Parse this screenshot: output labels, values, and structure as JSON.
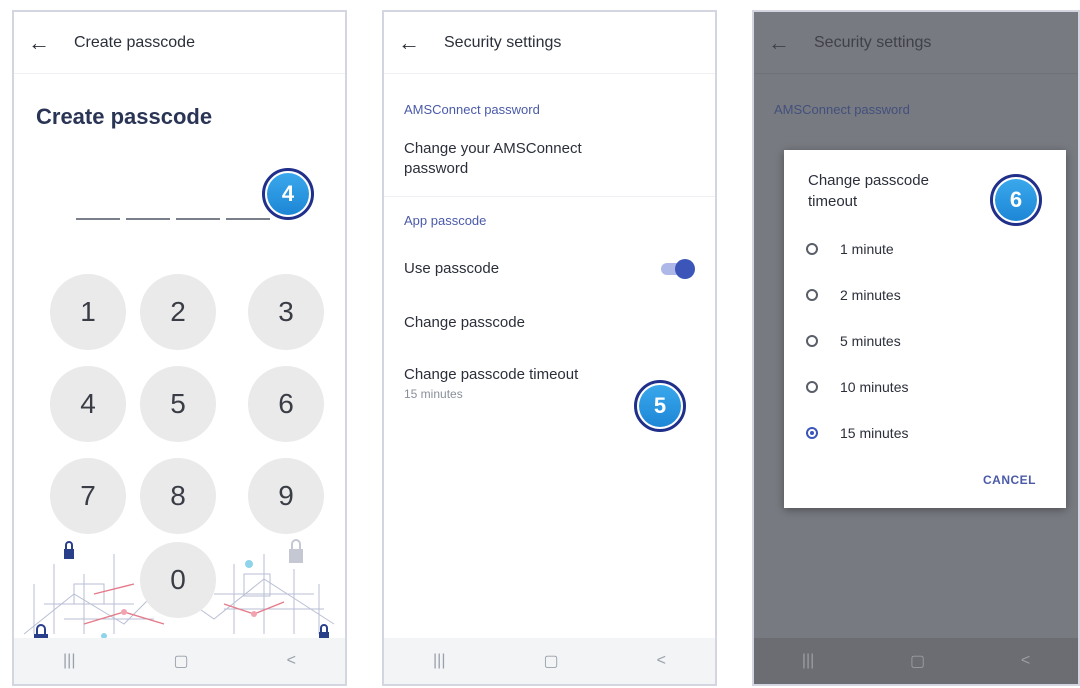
{
  "phone1": {
    "appbar_title": "Create passcode",
    "heading": "Create passcode",
    "keys": [
      "1",
      "2",
      "3",
      "4",
      "5",
      "6",
      "7",
      "8",
      "9",
      "0"
    ],
    "nav": [
      "|||",
      "▢",
      "<"
    ]
  },
  "phone2": {
    "appbar_title": "Security settings",
    "section1": "AMSConnect password",
    "change_password": "Change your AMSConnect password",
    "section2": "App passcode",
    "use_passcode": "Use passcode",
    "use_passcode_on": true,
    "change_passcode": "Change passcode",
    "timeout_label": "Change passcode timeout",
    "timeout_value": "15 minutes",
    "nav": [
      "|||",
      "▢",
      "<"
    ]
  },
  "phone3": {
    "appbar_title": "Security settings",
    "section1": "AMSConnect password",
    "dialog": {
      "title": "Change passcode timeout",
      "options": [
        "1 minute",
        "2 minutes",
        "5 minutes",
        "10 minutes",
        "15 minutes"
      ],
      "selected": "15 minutes",
      "cancel": "CANCEL"
    },
    "nav": [
      "|||",
      "▢",
      "<"
    ]
  },
  "steps": {
    "step4": "4",
    "step5": "5",
    "step6": "6"
  },
  "icons": {
    "back": "arrow-left-icon",
    "lock": "padlock-icon"
  },
  "colors": {
    "accent": "#3b56b8",
    "section": "#4a5aa8",
    "badge_fill": "#2a97e2",
    "badge_ring": "#1f2f8a"
  }
}
